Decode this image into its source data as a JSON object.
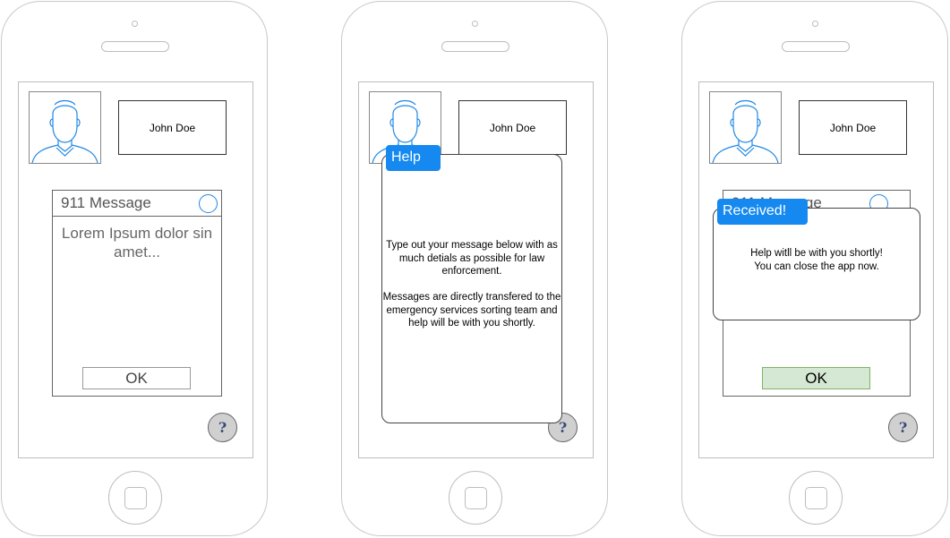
{
  "screens": [
    {
      "id": "compose",
      "contact_name": "John Doe",
      "message_panel": {
        "title": "911 Message",
        "body": "Lorem Ipsum dolor sin amet...",
        "ok_label": "OK"
      },
      "help_label": "?"
    },
    {
      "id": "help",
      "contact_name": "John Doe",
      "help_label": "?",
      "dialog": {
        "tag": "Help",
        "paragraph_1": "Type out your message below with as much detials as possible for law enforcement.",
        "paragraph_2": "Messages are directly transfered to the emergency services sorting team and help will be with you shortly."
      }
    },
    {
      "id": "received",
      "contact_name": "John Doe",
      "help_label": "?",
      "message_panel": {
        "title": "911 Message",
        "ok_label": "OK"
      },
      "dialog": {
        "tag": "Received!",
        "line_1": "Help witll be with you shortly!",
        "line_2": "You can close the app now."
      }
    }
  ],
  "colors": {
    "accent": "#1589f0",
    "confirm_fill": "#d5e8d4",
    "confirm_border": "#82b366",
    "avatar_stroke": "#1e88e5",
    "help_button_fill": "#d0d0d0"
  },
  "icons": {
    "avatar": "user-avatar-icon",
    "help": "question-mark-icon",
    "radio": "radio-circle-icon"
  }
}
